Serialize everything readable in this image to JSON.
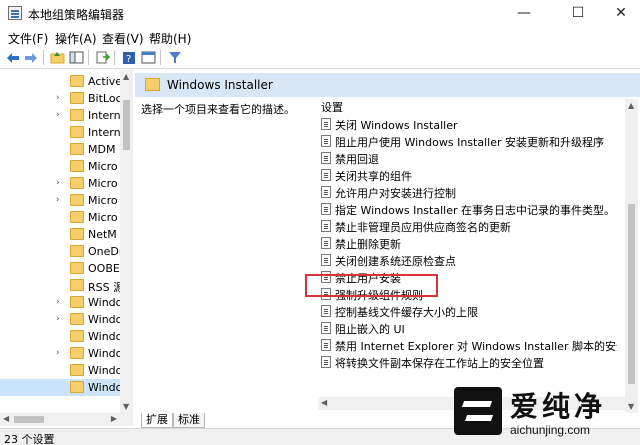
{
  "window": {
    "title": "本地组策略编辑器",
    "minimize_glyph": "—",
    "maximize_glyph": "☐",
    "close_glyph": "✕"
  },
  "menu": {
    "items": [
      "文件(F)",
      "操作(A)",
      "查看(V)",
      "帮助(H)"
    ]
  },
  "toolbar": {
    "icons": [
      "back-arrow-icon",
      "forward-arrow-icon",
      "folder-up-icon",
      "show-hide-tree-icon",
      "export-list-icon",
      "help-icon",
      "properties-icon",
      "filter-icon"
    ]
  },
  "tree": {
    "items": [
      {
        "label": "Active",
        "expandable": false,
        "selected": false
      },
      {
        "label": "BitLoc",
        "expandable": true,
        "selected": false
      },
      {
        "label": "Intern",
        "expandable": true,
        "selected": false
      },
      {
        "label": "Intern",
        "expandable": false,
        "selected": false
      },
      {
        "label": "MDM",
        "expandable": false,
        "selected": false
      },
      {
        "label": "Micro",
        "expandable": false,
        "selected": false
      },
      {
        "label": "Micro",
        "expandable": true,
        "selected": false
      },
      {
        "label": "Micro",
        "expandable": true,
        "selected": false
      },
      {
        "label": "Micro",
        "expandable": false,
        "selected": false
      },
      {
        "label": "NetM",
        "expandable": false,
        "selected": false
      },
      {
        "label": "OneDr",
        "expandable": false,
        "selected": false
      },
      {
        "label": "OOBE",
        "expandable": false,
        "selected": false
      },
      {
        "label": "RSS 源",
        "expandable": false,
        "selected": false
      },
      {
        "label": "Windo",
        "expandable": true,
        "selected": false
      },
      {
        "label": "Windo",
        "expandable": true,
        "selected": false
      },
      {
        "label": "Windo",
        "expandable": false,
        "selected": false
      },
      {
        "label": "Windo",
        "expandable": true,
        "selected": false
      },
      {
        "label": "Windo",
        "expandable": false,
        "selected": false
      },
      {
        "label": "Windo",
        "expandable": false,
        "selected": true
      }
    ]
  },
  "content": {
    "header_title": "Windows Installer",
    "description": "选择一个项目来查看它的描述。",
    "list_header": "设置",
    "settings": [
      "关闭 Windows Installer",
      "阻止用户使用 Windows Installer 安装更新和升级程序",
      "禁用回退",
      "关闭共享的组件",
      "允许用户对安装进行控制",
      "指定 Windows Installer 在事务日志中记录的事件类型。",
      "禁止非管理员应用供应商签名的更新",
      "禁止删除更新",
      "关闭创建系统还原检查点",
      "禁止用户安装",
      "强制升级组件规则",
      "控制基线文件缓存大小的上限",
      "阻止嵌入的 UI",
      "禁用 Internet Explorer 对 Windows Installer 脚本的安全...",
      "将转换文件副本保存在工作站上的安全位置"
    ],
    "highlighted_setting_index": 9
  },
  "tabs": [
    {
      "label": "扩展",
      "active": true
    },
    {
      "label": "标准",
      "active": false
    }
  ],
  "status": {
    "text": "23 个设置"
  },
  "watermark": {
    "cn_text": "爱纯净",
    "url": "aichunjing.com"
  },
  "colors": {
    "header_bg": "#d8e6f5",
    "selected_row": "#cce4f7",
    "highlight_border": "#d9333a",
    "folder_fill": "#f5cf6a"
  }
}
